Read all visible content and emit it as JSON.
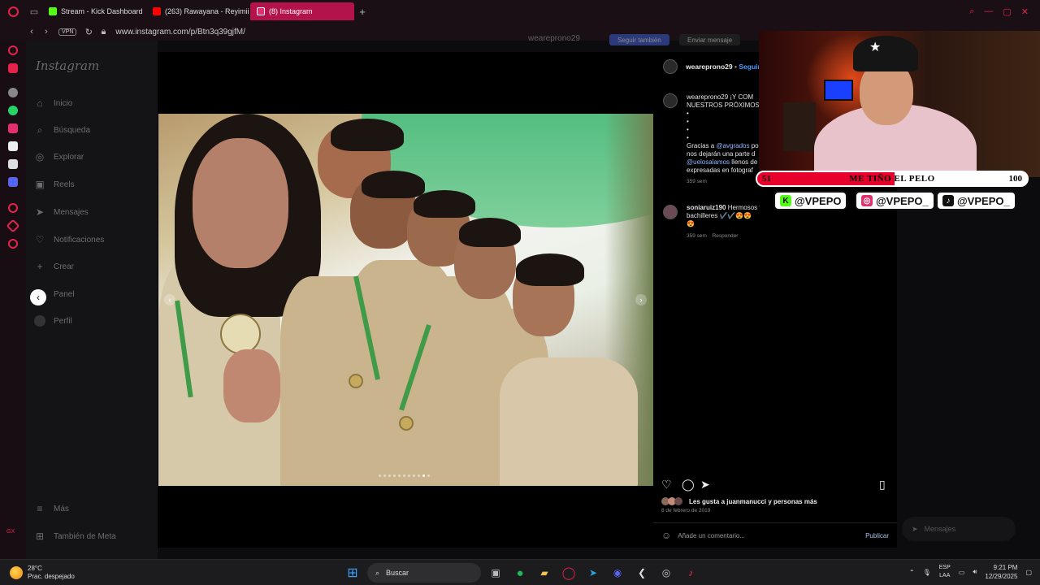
{
  "browser": {
    "tabs": [
      {
        "label": "Stream - Kick Dashboard",
        "color": "#53fc18"
      },
      {
        "label": "(263) Rawayana - Reyimii",
        "color": "#ff0000"
      },
      {
        "label": "(8) Instagram",
        "color": "#e1306c"
      }
    ],
    "vpn": "VPN",
    "url": "www.instagram.com/p/Btn3q39gjfM/"
  },
  "opera_side": {
    "bottom_label": "GX"
  },
  "instagram": {
    "logo": "Instagram",
    "nav": [
      {
        "label": "Inicio",
        "icon": "home-icon",
        "glyph": "⌂"
      },
      {
        "label": "Búsqueda",
        "icon": "search-icon",
        "glyph": "⌕"
      },
      {
        "label": "Explorar",
        "icon": "compass-icon",
        "glyph": "◎"
      },
      {
        "label": "Reels",
        "icon": "reels-icon",
        "glyph": "▣"
      },
      {
        "label": "Mensajes",
        "icon": "messenger-icon",
        "glyph": "➤"
      },
      {
        "label": "Notificaciones",
        "icon": "heart-icon",
        "glyph": "♡"
      },
      {
        "label": "Crear",
        "icon": "plus-icon",
        "glyph": "+"
      },
      {
        "label": "Panel",
        "icon": "dashboard-icon",
        "glyph": "▤"
      },
      {
        "label": "Perfil",
        "icon": "profile-avatar-icon",
        "glyph": ""
      }
    ],
    "more": "Más",
    "meta": "También de Meta",
    "back_header": {
      "username": "weareprono29",
      "follow": "Seguir también",
      "message": "Enviar mensaje"
    }
  },
  "post": {
    "username": "weareprono29",
    "follow": "Seguir",
    "caption_lines": [
      "weareprono29 ¡Y COM",
      "NUESTROS PRÓXIMOS"
    ],
    "caption_dots": [
      "•",
      "•",
      "•",
      "•"
    ],
    "caption_rest": [
      "Gracias a",
      "@avgrados",
      "po",
      "nos dejarán una parte d",
      "@uelosalamos",
      "llenos de",
      "expresadas en fotograf"
    ],
    "caption_time": "359 sem",
    "comment": {
      "user": "soniaruiz190",
      "text": "Hermosos todos",
      "text2": "bachilleres ✔️✔️😍😍😍",
      "time": "359 sem",
      "reply": "Responder"
    },
    "likes": "Les gusta a juanmanucci y personas más",
    "date": "8 de febrero de 2019",
    "add_comment": "Añade un comentario...",
    "publish": "Publicar",
    "messages_pill": "Mensajes"
  },
  "overlay": {
    "goal": {
      "current": "51",
      "title": "ME TIÑO EL PELO",
      "target": "100",
      "fraction": 0.51
    },
    "handles": [
      {
        "platform": "kick",
        "text": "@VPEPO",
        "color": "#53fc18",
        "glyph": "K"
      },
      {
        "platform": "instagram",
        "text": "@VPEPO_",
        "color": "#e1306c",
        "glyph": "◎"
      },
      {
        "platform": "tiktok",
        "text": "@VPEPO_",
        "color": "#111111",
        "glyph": "♪"
      }
    ]
  },
  "taskbar": {
    "weather_temp": "28°C",
    "weather_desc": "Prac. despejado",
    "search": "Buscar",
    "lang1": "ESP",
    "lang2": "LAA",
    "time": "9:21 PM",
    "date": "12/29/2025"
  }
}
